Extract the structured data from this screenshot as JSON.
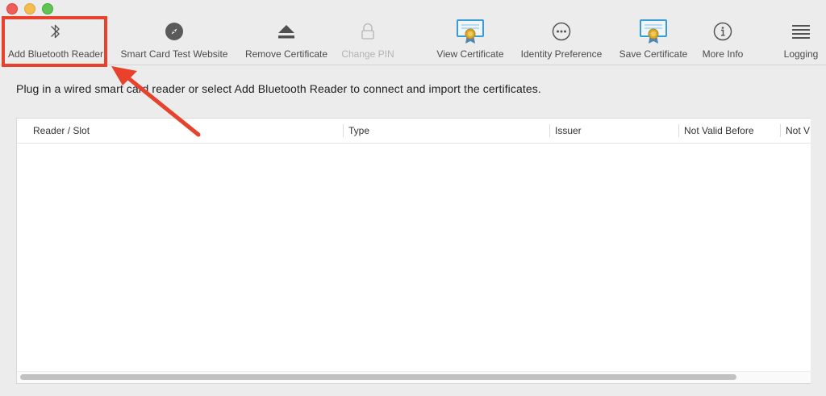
{
  "window": {
    "controls": [
      "close",
      "minimize",
      "maximize"
    ]
  },
  "toolbar": {
    "items": [
      {
        "label": "Add Bluetooth Reader",
        "icon": "bluetooth-icon",
        "enabled": true
      },
      {
        "label": "Smart Card Test Website",
        "icon": "compass-icon",
        "enabled": true
      },
      {
        "label": "Remove Certificate",
        "icon": "eject-icon",
        "enabled": true
      },
      {
        "label": "Change PIN",
        "icon": "lock-icon",
        "enabled": false
      },
      {
        "label": "View Certificate",
        "icon": "certificate-icon",
        "enabled": true
      },
      {
        "label": "Identity Preference",
        "icon": "ellipsis-circle-icon",
        "enabled": true
      },
      {
        "label": "Save Certificate",
        "icon": "certificate-icon",
        "enabled": true
      },
      {
        "label": "More Info",
        "icon": "info-circle-icon",
        "enabled": true
      },
      {
        "label": "Logging",
        "icon": "list-icon",
        "enabled": true
      }
    ]
  },
  "main": {
    "instruction": "Plug in a wired smart card reader or select Add Bluetooth Reader to connect and import the certificates."
  },
  "table": {
    "columns": [
      "Reader / Slot",
      "Type",
      "Issuer",
      "Not Valid Before",
      "Not V"
    ],
    "rows": []
  },
  "annotation": {
    "highlight_color": "#e8412c",
    "target": "Add Bluetooth Reader"
  }
}
